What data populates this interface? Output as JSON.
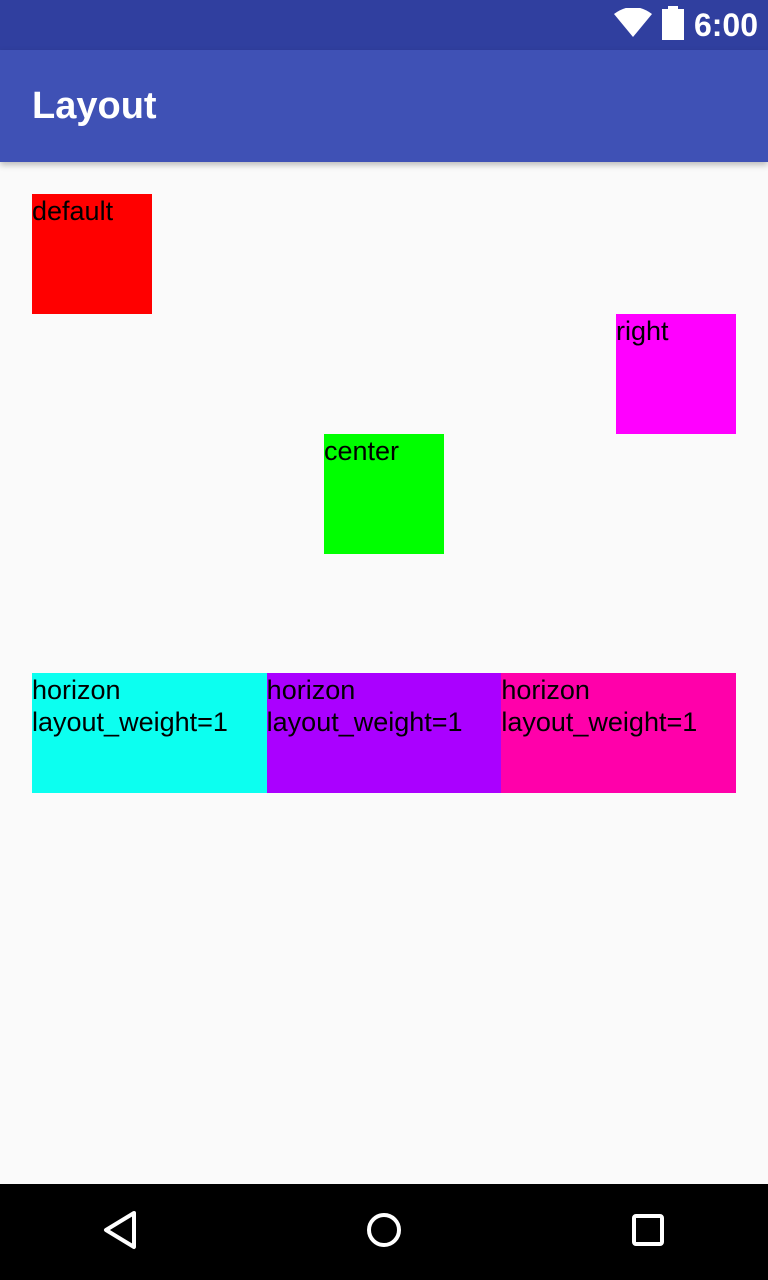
{
  "status_bar": {
    "time": "6:00",
    "icons": [
      "wifi-icon",
      "battery-icon"
    ]
  },
  "app_bar": {
    "title": "Layout"
  },
  "boxes": {
    "default": {
      "label": "default",
      "color": "#ff0000"
    },
    "right": {
      "label": "right",
      "color": "#ff00ff"
    },
    "center": {
      "label": "center",
      "color": "#00ff00"
    }
  },
  "horizontal_row": [
    {
      "line1": "horizon",
      "line2": "layout_weight=1",
      "color": "#0cfff0"
    },
    {
      "line1": "horizon",
      "line2": "layout_weight=1",
      "color": "#aa00ff"
    },
    {
      "line1": "horizon",
      "line2": "layout_weight=1",
      "color": "#ff00aa"
    }
  ],
  "nav_bar": {
    "buttons": [
      "back-icon",
      "home-icon",
      "recents-icon"
    ]
  }
}
